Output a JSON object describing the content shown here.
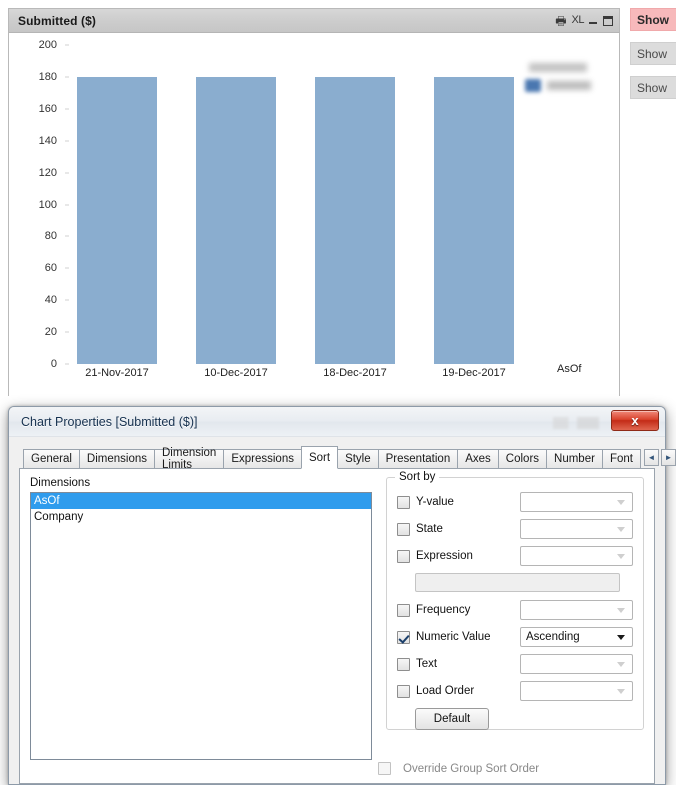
{
  "chart": {
    "title": "Submitted ($)",
    "caption_icons": [
      {
        "name": "print-icon",
        "glyph": "Ὓ6"
      },
      {
        "name": "excel-export-icon",
        "glyph": "XL"
      },
      {
        "name": "minimize-icon",
        "glyph": ""
      },
      {
        "name": "maximize-icon",
        "glyph": ""
      }
    ],
    "bar_color": "#8aadcf",
    "legend_redacted": true
  },
  "chart_data": {
    "type": "bar",
    "title": "Submitted ($)",
    "categories": [
      "21-Nov-2017",
      "10-Dec-2017",
      "18-Dec-2017",
      "19-Dec-2017"
    ],
    "values": [
      180,
      180,
      180,
      180
    ],
    "xlabel": "AsOf",
    "ylabel": "",
    "ylim": [
      0,
      200
    ],
    "yticks": [
      0,
      20,
      40,
      60,
      80,
      100,
      120,
      140,
      160,
      180,
      200
    ],
    "grid": false,
    "legend_position": "top-right"
  },
  "show_buttons": [
    {
      "label": "Show",
      "active": true
    },
    {
      "label": "Show",
      "active": false
    },
    {
      "label": "Show",
      "active": false
    }
  ],
  "dialog": {
    "title": "Chart Properties [Submitted ($)]",
    "close_label": "x",
    "tabs": [
      {
        "label": "General",
        "active": false
      },
      {
        "label": "Dimensions",
        "active": false
      },
      {
        "label": "Dimension Limits",
        "active": false
      },
      {
        "label": "Expressions",
        "active": false
      },
      {
        "label": "Sort",
        "active": true
      },
      {
        "label": "Style",
        "active": false
      },
      {
        "label": "Presentation",
        "active": false
      },
      {
        "label": "Axes",
        "active": false
      },
      {
        "label": "Colors",
        "active": false
      },
      {
        "label": "Number",
        "active": false
      },
      {
        "label": "Font",
        "active": false
      }
    ],
    "tab_scroll_prev": "◄",
    "tab_scroll_next": "►",
    "dimensions": {
      "label": "Dimensions",
      "items": [
        {
          "label": "AsOf",
          "selected": true
        },
        {
          "label": "Company",
          "selected": false
        }
      ]
    },
    "sort_by": {
      "legend": "Sort by",
      "rows": [
        {
          "label": "Y-value",
          "checked": false,
          "value": "",
          "enabled": false
        },
        {
          "label": "State",
          "checked": false,
          "value": "",
          "enabled": false
        },
        {
          "label": "Expression",
          "checked": false,
          "value": "",
          "enabled": false
        },
        {
          "label": "Frequency",
          "checked": false,
          "value": "",
          "enabled": false
        },
        {
          "label": "Numeric Value",
          "checked": true,
          "value": "Ascending",
          "enabled": true
        },
        {
          "label": "Text",
          "checked": false,
          "value": "",
          "enabled": false
        },
        {
          "label": "Load Order",
          "checked": false,
          "value": "",
          "enabled": false
        }
      ],
      "expression_input": "",
      "default_button": "Default"
    },
    "override_group_sort_order": {
      "label": "Override Group Sort Order",
      "checked": false,
      "enabled": false
    }
  }
}
